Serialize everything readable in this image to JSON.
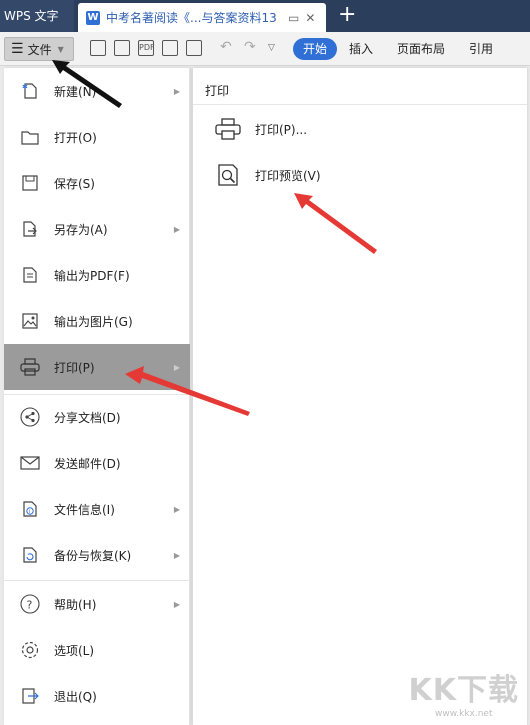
{
  "tabs": {
    "app_label": "WPS 文字",
    "doc_title": "中考名著阅读《...与答案资料13",
    "doc_icon_letter": "W"
  },
  "toolbar": {
    "file_label": "文件",
    "ribbon_tabs": [
      "开始",
      "插入",
      "页面布局",
      "引用"
    ],
    "pdf_icon_text": "PDF"
  },
  "menu": {
    "items": [
      {
        "label": "新建(N)"
      },
      {
        "label": "打开(O)"
      },
      {
        "label": "保存(S)"
      },
      {
        "label": "另存为(A)"
      },
      {
        "label": "输出为PDF(F)"
      },
      {
        "label": "输出为图片(G)"
      },
      {
        "label": "打印(P)"
      },
      {
        "label": "分享文档(D)"
      },
      {
        "label": "发送邮件(D)"
      },
      {
        "label": "文件信息(I)"
      },
      {
        "label": "备份与恢复(K)"
      },
      {
        "label": "帮助(H)"
      },
      {
        "label": "选项(L)"
      },
      {
        "label": "退出(Q)"
      }
    ]
  },
  "submenu": {
    "header": "打印",
    "items": [
      {
        "label": "打印(P)..."
      },
      {
        "label": "打印预览(V)"
      }
    ]
  },
  "watermark": {
    "brand": "KK下载",
    "url": "www.kkx.net"
  },
  "colors": {
    "accent": "#2f6fd6",
    "titlebar": "#2b3f5c",
    "active_item": "#9b9b9b",
    "arrow_red": "#e53935"
  }
}
